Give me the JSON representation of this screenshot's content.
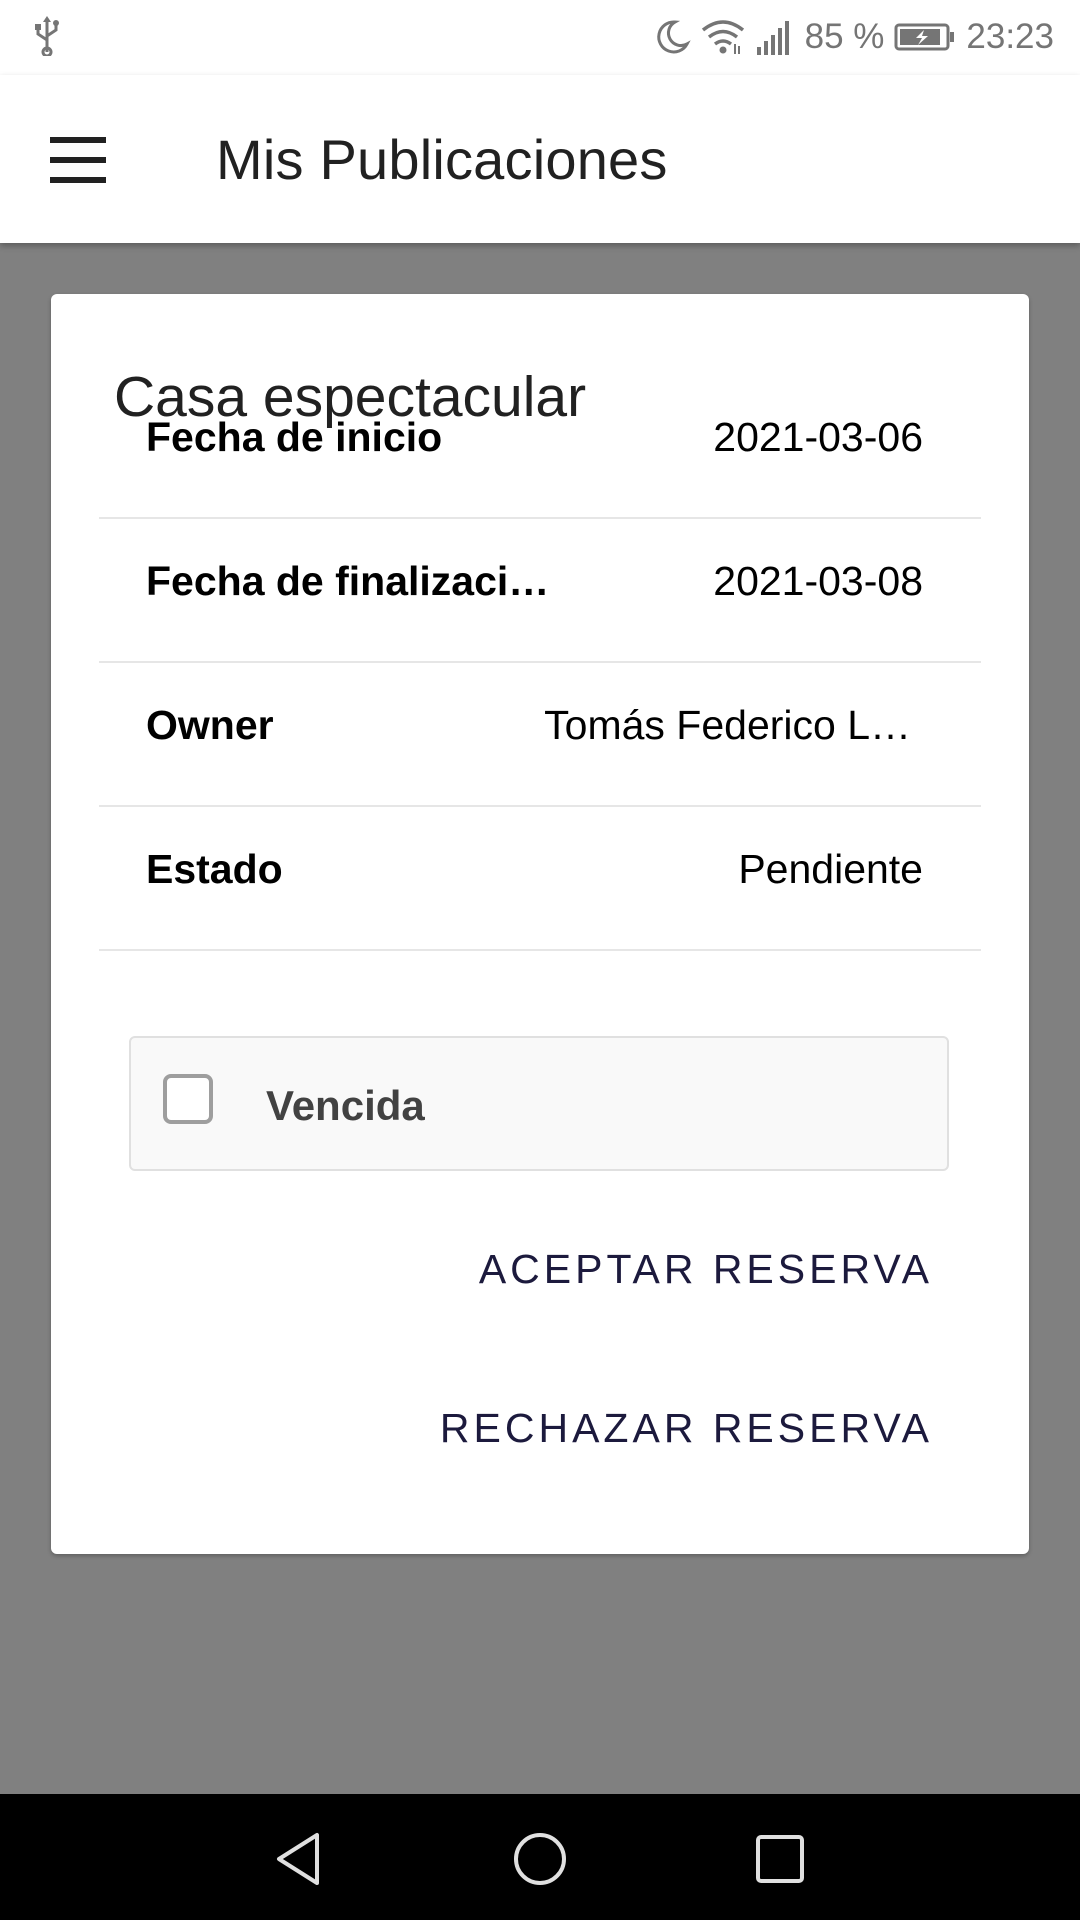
{
  "status_bar": {
    "battery_percent": "85 %",
    "time": "23:23",
    "icons": [
      "usb-icon",
      "moon-icon",
      "wifi-icon",
      "signal-icon",
      "battery-icon"
    ]
  },
  "app_bar": {
    "title": "Mis Publicaciones",
    "menu_icon": "menu-icon"
  },
  "card": {
    "title": "Casa espectacular",
    "rows": [
      {
        "label": "Fecha de inicio",
        "value": "2021-03-06"
      },
      {
        "label": "Fecha de finalizaci…",
        "value": "2021-03-08"
      },
      {
        "label": "Owner",
        "value": "Tomás Federico L…"
      },
      {
        "label": "Estado",
        "value": "Pendiente"
      }
    ],
    "checkbox": {
      "label": "Vencida",
      "checked": false
    },
    "actions": {
      "accept_label": "ACEPTAR RESERVA",
      "reject_label": "RECHAZAR RESERVA"
    }
  },
  "colors": {
    "background_overlay": "#808080",
    "action_text": "#1c1a3d",
    "app_bar": "#ffffff"
  },
  "nav_bar": {
    "icons": [
      "back-icon",
      "home-icon",
      "recents-icon"
    ]
  }
}
